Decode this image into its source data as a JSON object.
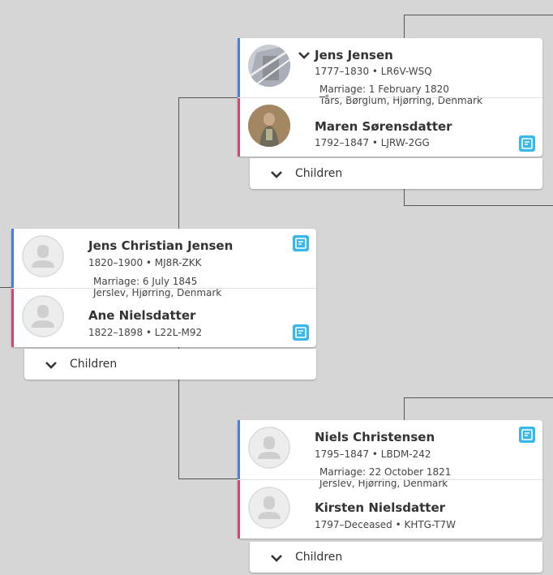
{
  "focus_couple": {
    "husband": {
      "name": "Jens Christian Jensen",
      "dates": "1820–1900 • MJ8R-ZKK"
    },
    "marriage": {
      "date": "Marriage: 6 July 1845",
      "place": "Jerslev, Hjørring, Denmark"
    },
    "wife": {
      "name": "Ane Nielsdatter",
      "dates": "1822–1898 • L22L-M92"
    },
    "children_label": "Children"
  },
  "paternal_couple": {
    "husband": {
      "name": "Jens Jensen",
      "dates": "1777–1830 • LR6V-WSQ"
    },
    "marriage": {
      "date": "Marriage: 1 February 1820",
      "place": "Tårs, Børglum, Hjørring, Denmark"
    },
    "wife": {
      "name": "Maren Sørensdatter",
      "dates": "1792–1847 • LJRW-2GG"
    },
    "children_label": "Children"
  },
  "maternal_couple": {
    "husband": {
      "name": "Niels Christensen",
      "dates": "1795–1847 • LBDM-242"
    },
    "marriage": {
      "date": "Marriage: 22 October 1821",
      "place": "Jerslev, Hjørring, Denmark"
    },
    "wife": {
      "name": "Kirsten Nielsdatter",
      "dates": "1797–Deceased • KHTG-T7W"
    },
    "children_label": "Children"
  },
  "colors": {
    "male_border": "#4a7fe0",
    "female_border": "#d5437b",
    "note_icon": "#38b7ea",
    "canvas": "#d6d6d6"
  },
  "icons": [
    "chevron-down-icon",
    "person-silhouette-icon",
    "source-note-icon"
  ]
}
